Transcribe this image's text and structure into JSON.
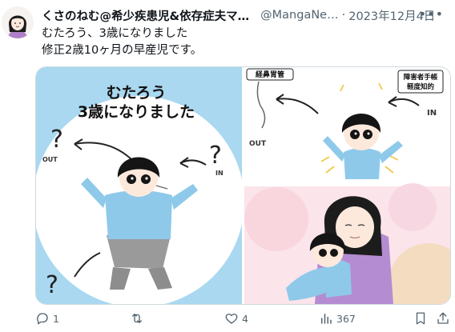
{
  "user": {
    "name": "くさのねむ@希少疾患児&依存症夫マ…",
    "handle": "@MangaNe…",
    "separator": "·",
    "date": "2023年12月4日"
  },
  "tweet": {
    "line1": "むたろう、3歳になりました",
    "line2": "修正2歳10ヶ月の早産児です。"
  },
  "image_text": {
    "title_line1": "むたろう",
    "title_line2": "3歳になりました",
    "out_left": "OUT",
    "in_left": "IN",
    "tag_left_top": "経鼻胃管",
    "out_right": "OUT",
    "tag_right_line1": "障害者手帳",
    "tag_right_line2": "軽度知的",
    "in_right": "IN"
  },
  "actions": {
    "reply_count": "1",
    "retweet_count": "",
    "like_count": "4",
    "view_count": "367"
  },
  "icons": {
    "more": "more-icon",
    "reply": "reply-icon",
    "retweet": "retweet-icon",
    "like": "like-icon",
    "views": "views-icon",
    "bookmark": "bookmark-icon",
    "share": "share-icon"
  },
  "colors": {
    "text": "#0f1419",
    "secondary": "#536471",
    "panel_blue": "#a9d8f0",
    "shirt_blue": "#8ec9ea"
  }
}
